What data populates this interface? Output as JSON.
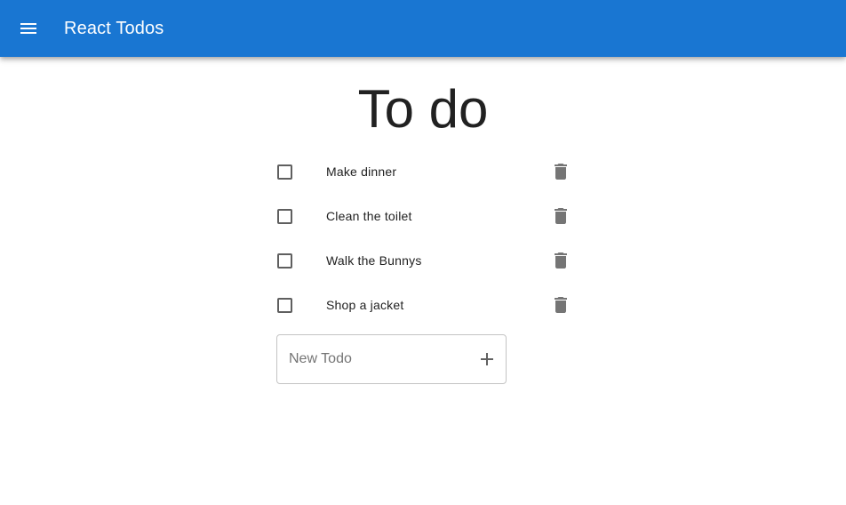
{
  "appbar": {
    "title": "React Todos",
    "menu_icon": "menu-icon",
    "color": "#1976d2"
  },
  "page": {
    "title": "To do"
  },
  "todos": [
    {
      "label": "Make dinner",
      "checked": false
    },
    {
      "label": "Clean the toilet",
      "checked": false
    },
    {
      "label": "Walk the Bunnys",
      "checked": false
    },
    {
      "label": "Shop a jacket",
      "checked": false
    }
  ],
  "icons": {
    "delete": "trash-icon",
    "add": "plus-icon",
    "checkbox": "checkbox-unchecked-icon"
  },
  "new_todo": {
    "placeholder": "New Todo",
    "value": ""
  }
}
